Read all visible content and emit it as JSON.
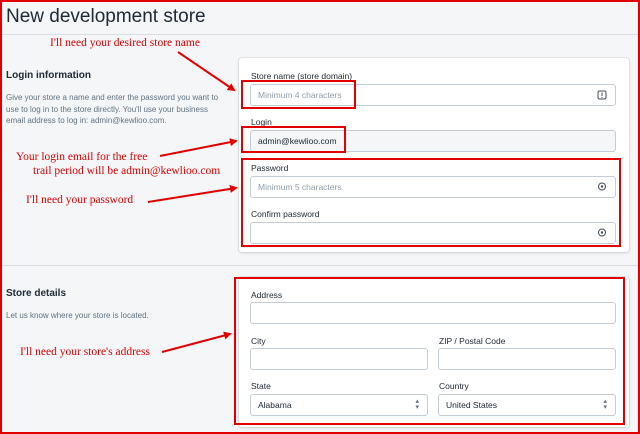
{
  "page": {
    "title": "New development store"
  },
  "login_section": {
    "title": "Login information",
    "description": "Give your store a name and enter the password you want to use to log in to the store directly. You'll use your business email address to log in: admin@kewlioo.com."
  },
  "store_section": {
    "title": "Store details",
    "description": "Let us know where your store is located."
  },
  "fields": {
    "store_name": {
      "label": "Store name (store domain)",
      "placeholder": "Minimum 4 characters"
    },
    "login": {
      "label": "Login",
      "value": "admin@kewlioo.com"
    },
    "password": {
      "label": "Password",
      "placeholder": "Minimum 5 characters"
    },
    "confirm_password": {
      "label": "Confirm password",
      "placeholder": ""
    },
    "address": {
      "label": "Address",
      "value": ""
    },
    "city": {
      "label": "City",
      "value": ""
    },
    "zip": {
      "label": "ZIP / Postal Code",
      "value": ""
    },
    "state": {
      "label": "State",
      "value": "Alabama"
    },
    "country": {
      "label": "Country",
      "value": "United States"
    }
  },
  "annotations": {
    "store_name": "I'll need your desired store name",
    "login_line1": "Your login email for the free",
    "login_line2": "trail period will be admin@kewlioo.com",
    "password": "I'll need your password",
    "address": "I'll need your store's address"
  },
  "colors": {
    "annotation": "#e00000",
    "page_bg": "#f4f6f8",
    "card_bg": "#ffffff"
  },
  "icons": [
    "info-icon",
    "eye-icon",
    "chevron-updown-icon"
  ]
}
